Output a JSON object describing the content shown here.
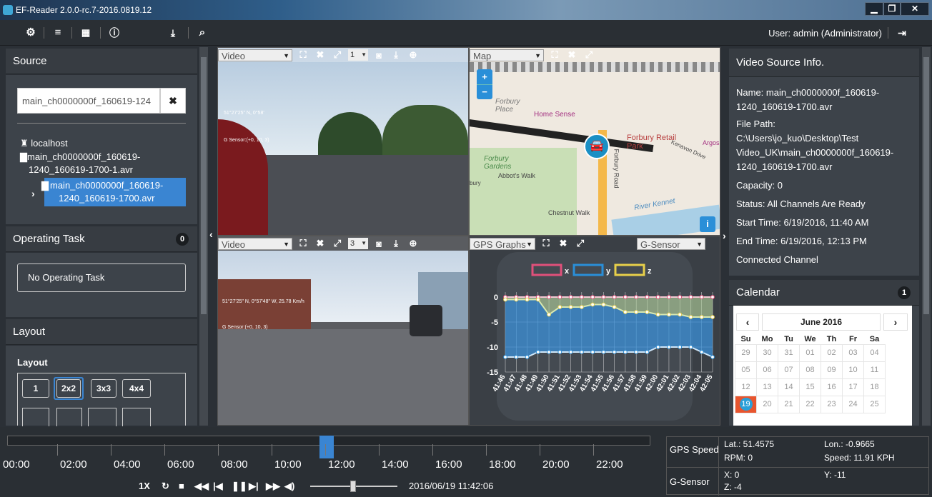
{
  "window": {
    "title": "EF-Reader 2.0.0-rc.7-2016.0819.12",
    "min": "▁",
    "max": "❐",
    "close": "✕"
  },
  "toolbar": {
    "user": "User: admin (Administrator)"
  },
  "source": {
    "header": "Source",
    "search_value": "main_ch0000000f_160619-124",
    "clear": "✖",
    "tree": {
      "root": "localhost",
      "file1_line1": "main_ch0000000f_160619-",
      "file1_line2": "1240_160619-1700-1.avr",
      "file2_line1": "main_ch0000000f_160619-",
      "file2_line2": "1240_160619-1700.avr"
    }
  },
  "tasks": {
    "header": "Operating Task",
    "count": "0",
    "empty": "No Operating Task"
  },
  "layout": {
    "header": "Layout",
    "subheader": "Layout",
    "buttons": [
      "1",
      "2x2",
      "3x3",
      "4x4"
    ],
    "selected": "2x2"
  },
  "panes": {
    "tl": {
      "select": "Video",
      "channel": "1",
      "coords": "51°27'25\" N, 0°58'",
      "gsensor": "G Sensor:(+0, 10, 3)"
    },
    "tr": {
      "select": "Map"
    },
    "bl": {
      "select": "Video",
      "channel": "3",
      "coords": "51°27'25\" N, 0°57'48\" W, 25.78 Km/h",
      "gsensor": "G Sensor:(+0, 10, 3)"
    },
    "br": {
      "select": "GPS Graphs",
      "select2": "G-Sensor"
    }
  },
  "map": {
    "labels": [
      "Forbury Place",
      "Home Sense",
      "Forbury Retail Park",
      "Kenavon Drive",
      "Forbury Gardens",
      "Abbot's Walk",
      "Forbury Road",
      "Chestnut Walk",
      "River Kennet",
      "Argos",
      "bury"
    ],
    "zoom_in": "+",
    "zoom_out": "−",
    "info": "i"
  },
  "chart_data": {
    "type": "line",
    "title": "",
    "legend": [
      "x",
      "y",
      "z"
    ],
    "legend_placement": "top",
    "colors": {
      "x": "#e0507a",
      "y": "#2a8fd8",
      "z": "#e8d04a"
    },
    "ylim": [
      -15,
      1
    ],
    "yticks": [
      0,
      -5,
      -10,
      -15
    ],
    "categories": [
      "41:46",
      "41:47",
      "41:48",
      "41:49",
      "41:50",
      "41:51",
      "41:52",
      "41:53",
      "41:54",
      "41:55",
      "41:56",
      "41:57",
      "41:58",
      "41:59",
      "42:00",
      "42:01",
      "42:02",
      "42:03",
      "42:04",
      "42:05"
    ],
    "series": [
      {
        "name": "x",
        "values": [
          0,
          0,
          0,
          0,
          0,
          0,
          0,
          0,
          0,
          0,
          0,
          0,
          0,
          0,
          0,
          0,
          0,
          0,
          0,
          0
        ]
      },
      {
        "name": "z",
        "values": [
          -0.5,
          -0.5,
          -0.5,
          -0.5,
          -3.5,
          -2,
          -2,
          -2,
          -1.5,
          -1.5,
          -2,
          -3,
          -3,
          -3,
          -3.5,
          -3.5,
          -3.5,
          -4,
          -4,
          -4
        ]
      },
      {
        "name": "y",
        "values": [
          -12,
          -12,
          -12,
          -11,
          -11,
          -11,
          -11,
          -11,
          -11,
          -11,
          -11,
          -11,
          -11,
          -11,
          -10,
          -10,
          -10,
          -10,
          -11,
          -12
        ]
      }
    ]
  },
  "videoinfo": {
    "header": "Video Source Info.",
    "name1": "Name: main_ch0000000f_160619-",
    "name2": "1240_160619-1700.avr",
    "path_label": "File Path:",
    "path1": "C:\\Users\\jo_kuo\\Desktop\\Test",
    "path2": "Video_UK\\main_ch0000000f_160619-",
    "path3": "1240_160619-1700.avr",
    "capacity": "Capacity: 0",
    "status": "Status: All Channels Are Ready",
    "start": "Start Time: 6/19/2016, 11:40 AM",
    "end": "End Time: 6/19/2016, 12:13 PM",
    "connected": "Connected Channel"
  },
  "calendar": {
    "header": "Calendar",
    "count": "1",
    "month": "June 2016",
    "days": [
      "Su",
      "Mo",
      "Tu",
      "We",
      "Th",
      "Fr",
      "Sa"
    ],
    "weeks": [
      [
        "29",
        "30",
        "31",
        "01",
        "02",
        "03",
        "04"
      ],
      [
        "05",
        "06",
        "07",
        "08",
        "09",
        "10",
        "11"
      ],
      [
        "12",
        "13",
        "14",
        "15",
        "16",
        "17",
        "18"
      ],
      [
        "19",
        "20",
        "21",
        "22",
        "23",
        "24",
        "25"
      ]
    ],
    "selected": "19"
  },
  "timeline": {
    "labels": [
      "00:00",
      "02:00",
      "04:00",
      "06:00",
      "08:00",
      "10:00",
      "12:00",
      "14:00",
      "16:00",
      "18:00",
      "20:00",
      "22:00"
    ],
    "speed": "1X",
    "datetime": "2016/06/19 11:42:06"
  },
  "gps": {
    "speed_label": "GPS Speed",
    "lat": "Lat.: 51.4575",
    "lon": "Lon.: -0.9665",
    "rpm": "RPM: 0",
    "speed": "Speed: 11.91 KPH",
    "gsensor_label": "G-Sensor",
    "x": "X: 0",
    "y": "Y: -11",
    "z": "Z: -4"
  }
}
